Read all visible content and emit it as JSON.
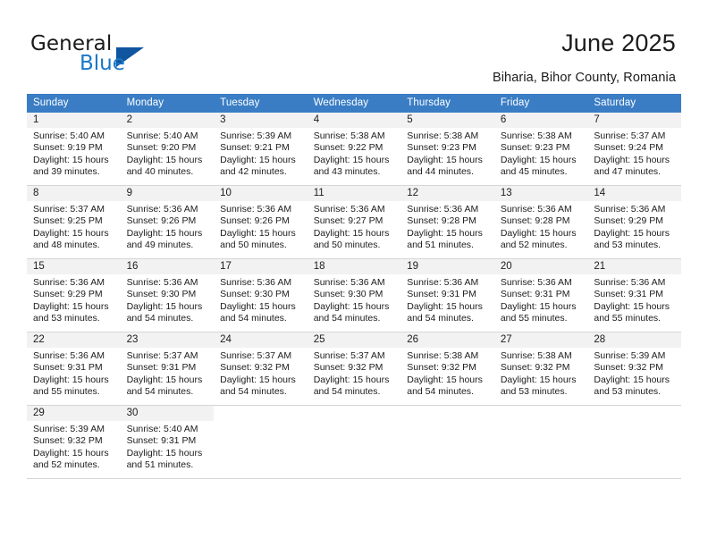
{
  "brand": {
    "name_part1": "General",
    "name_part2": "Blue",
    "accent_color": "#1878c8",
    "triangle_color": "#10559f"
  },
  "header": {
    "title": "June 2025",
    "subtitle": "Biharia, Bihor County, Romania"
  },
  "calendar": {
    "header_bg": "#3a7dc4",
    "weekday_headers": [
      "Sunday",
      "Monday",
      "Tuesday",
      "Wednesday",
      "Thursday",
      "Friday",
      "Saturday"
    ],
    "weeks": [
      [
        {
          "day": "1",
          "sunrise": "Sunrise: 5:40 AM",
          "sunset": "Sunset: 9:19 PM",
          "daylight1": "Daylight: 15 hours",
          "daylight2": "and 39 minutes."
        },
        {
          "day": "2",
          "sunrise": "Sunrise: 5:40 AM",
          "sunset": "Sunset: 9:20 PM",
          "daylight1": "Daylight: 15 hours",
          "daylight2": "and 40 minutes."
        },
        {
          "day": "3",
          "sunrise": "Sunrise: 5:39 AM",
          "sunset": "Sunset: 9:21 PM",
          "daylight1": "Daylight: 15 hours",
          "daylight2": "and 42 minutes."
        },
        {
          "day": "4",
          "sunrise": "Sunrise: 5:38 AM",
          "sunset": "Sunset: 9:22 PM",
          "daylight1": "Daylight: 15 hours",
          "daylight2": "and 43 minutes."
        },
        {
          "day": "5",
          "sunrise": "Sunrise: 5:38 AM",
          "sunset": "Sunset: 9:23 PM",
          "daylight1": "Daylight: 15 hours",
          "daylight2": "and 44 minutes."
        },
        {
          "day": "6",
          "sunrise": "Sunrise: 5:38 AM",
          "sunset": "Sunset: 9:23 PM",
          "daylight1": "Daylight: 15 hours",
          "daylight2": "and 45 minutes."
        },
        {
          "day": "7",
          "sunrise": "Sunrise: 5:37 AM",
          "sunset": "Sunset: 9:24 PM",
          "daylight1": "Daylight: 15 hours",
          "daylight2": "and 47 minutes."
        }
      ],
      [
        {
          "day": "8",
          "sunrise": "Sunrise: 5:37 AM",
          "sunset": "Sunset: 9:25 PM",
          "daylight1": "Daylight: 15 hours",
          "daylight2": "and 48 minutes."
        },
        {
          "day": "9",
          "sunrise": "Sunrise: 5:36 AM",
          "sunset": "Sunset: 9:26 PM",
          "daylight1": "Daylight: 15 hours",
          "daylight2": "and 49 minutes."
        },
        {
          "day": "10",
          "sunrise": "Sunrise: 5:36 AM",
          "sunset": "Sunset: 9:26 PM",
          "daylight1": "Daylight: 15 hours",
          "daylight2": "and 50 minutes."
        },
        {
          "day": "11",
          "sunrise": "Sunrise: 5:36 AM",
          "sunset": "Sunset: 9:27 PM",
          "daylight1": "Daylight: 15 hours",
          "daylight2": "and 50 minutes."
        },
        {
          "day": "12",
          "sunrise": "Sunrise: 5:36 AM",
          "sunset": "Sunset: 9:28 PM",
          "daylight1": "Daylight: 15 hours",
          "daylight2": "and 51 minutes."
        },
        {
          "day": "13",
          "sunrise": "Sunrise: 5:36 AM",
          "sunset": "Sunset: 9:28 PM",
          "daylight1": "Daylight: 15 hours",
          "daylight2": "and 52 minutes."
        },
        {
          "day": "14",
          "sunrise": "Sunrise: 5:36 AM",
          "sunset": "Sunset: 9:29 PM",
          "daylight1": "Daylight: 15 hours",
          "daylight2": "and 53 minutes."
        }
      ],
      [
        {
          "day": "15",
          "sunrise": "Sunrise: 5:36 AM",
          "sunset": "Sunset: 9:29 PM",
          "daylight1": "Daylight: 15 hours",
          "daylight2": "and 53 minutes."
        },
        {
          "day": "16",
          "sunrise": "Sunrise: 5:36 AM",
          "sunset": "Sunset: 9:30 PM",
          "daylight1": "Daylight: 15 hours",
          "daylight2": "and 54 minutes."
        },
        {
          "day": "17",
          "sunrise": "Sunrise: 5:36 AM",
          "sunset": "Sunset: 9:30 PM",
          "daylight1": "Daylight: 15 hours",
          "daylight2": "and 54 minutes."
        },
        {
          "day": "18",
          "sunrise": "Sunrise: 5:36 AM",
          "sunset": "Sunset: 9:30 PM",
          "daylight1": "Daylight: 15 hours",
          "daylight2": "and 54 minutes."
        },
        {
          "day": "19",
          "sunrise": "Sunrise: 5:36 AM",
          "sunset": "Sunset: 9:31 PM",
          "daylight1": "Daylight: 15 hours",
          "daylight2": "and 54 minutes."
        },
        {
          "day": "20",
          "sunrise": "Sunrise: 5:36 AM",
          "sunset": "Sunset: 9:31 PM",
          "daylight1": "Daylight: 15 hours",
          "daylight2": "and 55 minutes."
        },
        {
          "day": "21",
          "sunrise": "Sunrise: 5:36 AM",
          "sunset": "Sunset: 9:31 PM",
          "daylight1": "Daylight: 15 hours",
          "daylight2": "and 55 minutes."
        }
      ],
      [
        {
          "day": "22",
          "sunrise": "Sunrise: 5:36 AM",
          "sunset": "Sunset: 9:31 PM",
          "daylight1": "Daylight: 15 hours",
          "daylight2": "and 55 minutes."
        },
        {
          "day": "23",
          "sunrise": "Sunrise: 5:37 AM",
          "sunset": "Sunset: 9:31 PM",
          "daylight1": "Daylight: 15 hours",
          "daylight2": "and 54 minutes."
        },
        {
          "day": "24",
          "sunrise": "Sunrise: 5:37 AM",
          "sunset": "Sunset: 9:32 PM",
          "daylight1": "Daylight: 15 hours",
          "daylight2": "and 54 minutes."
        },
        {
          "day": "25",
          "sunrise": "Sunrise: 5:37 AM",
          "sunset": "Sunset: 9:32 PM",
          "daylight1": "Daylight: 15 hours",
          "daylight2": "and 54 minutes."
        },
        {
          "day": "26",
          "sunrise": "Sunrise: 5:38 AM",
          "sunset": "Sunset: 9:32 PM",
          "daylight1": "Daylight: 15 hours",
          "daylight2": "and 54 minutes."
        },
        {
          "day": "27",
          "sunrise": "Sunrise: 5:38 AM",
          "sunset": "Sunset: 9:32 PM",
          "daylight1": "Daylight: 15 hours",
          "daylight2": "and 53 minutes."
        },
        {
          "day": "28",
          "sunrise": "Sunrise: 5:39 AM",
          "sunset": "Sunset: 9:32 PM",
          "daylight1": "Daylight: 15 hours",
          "daylight2": "and 53 minutes."
        }
      ],
      [
        {
          "day": "29",
          "sunrise": "Sunrise: 5:39 AM",
          "sunset": "Sunset: 9:32 PM",
          "daylight1": "Daylight: 15 hours",
          "daylight2": "and 52 minutes."
        },
        {
          "day": "30",
          "sunrise": "Sunrise: 5:40 AM",
          "sunset": "Sunset: 9:31 PM",
          "daylight1": "Daylight: 15 hours",
          "daylight2": "and 51 minutes."
        },
        {
          "day": "",
          "sunrise": "",
          "sunset": "",
          "daylight1": "",
          "daylight2": ""
        },
        {
          "day": "",
          "sunrise": "",
          "sunset": "",
          "daylight1": "",
          "daylight2": ""
        },
        {
          "day": "",
          "sunrise": "",
          "sunset": "",
          "daylight1": "",
          "daylight2": ""
        },
        {
          "day": "",
          "sunrise": "",
          "sunset": "",
          "daylight1": "",
          "daylight2": ""
        },
        {
          "day": "",
          "sunrise": "",
          "sunset": "",
          "daylight1": "",
          "daylight2": ""
        }
      ]
    ]
  }
}
